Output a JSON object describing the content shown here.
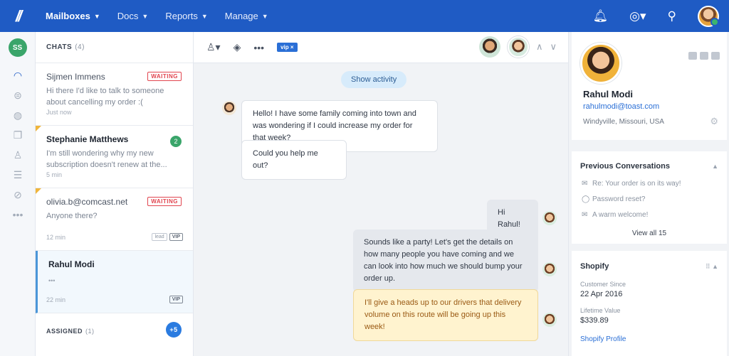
{
  "nav": {
    "logo": "//",
    "items": [
      {
        "label": "Mailboxes"
      },
      {
        "label": "Docs"
      },
      {
        "label": "Reports"
      },
      {
        "label": "Manage"
      }
    ]
  },
  "rail": {
    "user_initials": "SS"
  },
  "chat_list": {
    "header": "CHATS",
    "count": "(4)",
    "conversations": [
      {
        "name": "Sijmen Immens",
        "snippet": "Hi there I'd like to talk to someone about cancelling my order :(",
        "time": "Just now",
        "badge": "WAITING"
      },
      {
        "name": "Stephanie Matthews",
        "snippet": "I'm still wondering why my new subscription doesn't renew at the...",
        "time": "5 min",
        "badge": "2"
      },
      {
        "name": "olivia.b@comcast.net",
        "snippet": "Anyone there?",
        "time": "12 min",
        "badge": "WAITING",
        "tags": [
          "lead",
          "VIP"
        ]
      },
      {
        "name": "Rahul Modi",
        "snippet": "•••",
        "time": "22 min",
        "tags": [
          "VIP"
        ]
      }
    ],
    "assigned": {
      "label": "ASSIGNED",
      "count": "(1)",
      "more": "+5"
    }
  },
  "toolbar": {
    "vip_chip": "vip ×"
  },
  "chat": {
    "show_activity": "Show activity",
    "messages": [
      {
        "text": "Hello! I have some family coming into town and was wondering if I could increase my order for that week?"
      },
      {
        "text": "Could you help me out?"
      },
      {
        "text": "Hi Rahul!"
      },
      {
        "text": "Sounds like a party! Let's get the details on how many people you have coming and we can look into how much we should bump your order up."
      },
      {
        "text": "I'll give a heads up to our drivers that delivery volume on this route will be going up this week!"
      }
    ]
  },
  "profile": {
    "name": "Rahul Modi",
    "email": "rahulmodi@toast.com",
    "location": "Windyville, Missouri, USA"
  },
  "previous": {
    "title": "Previous Conversations",
    "items": [
      {
        "label": "Re: Your order is on its way!",
        "icon": "mail-icon"
      },
      {
        "label": "Password reset?",
        "icon": "chat-icon"
      },
      {
        "label": "A warm welcome!",
        "icon": "mail-icon"
      }
    ],
    "view_all": "View all 15"
  },
  "shopify": {
    "title": "Shopify",
    "customer_since_label": "Customer Since",
    "customer_since": "22 Apr 2016",
    "lifetime_label": "Lifetime Value",
    "lifetime": "$339.89",
    "profile_link": "Shopify Profile"
  },
  "colors": {
    "brand": "#1f5bc4",
    "waiting": "#e1454f",
    "online": "#3bb46e"
  }
}
